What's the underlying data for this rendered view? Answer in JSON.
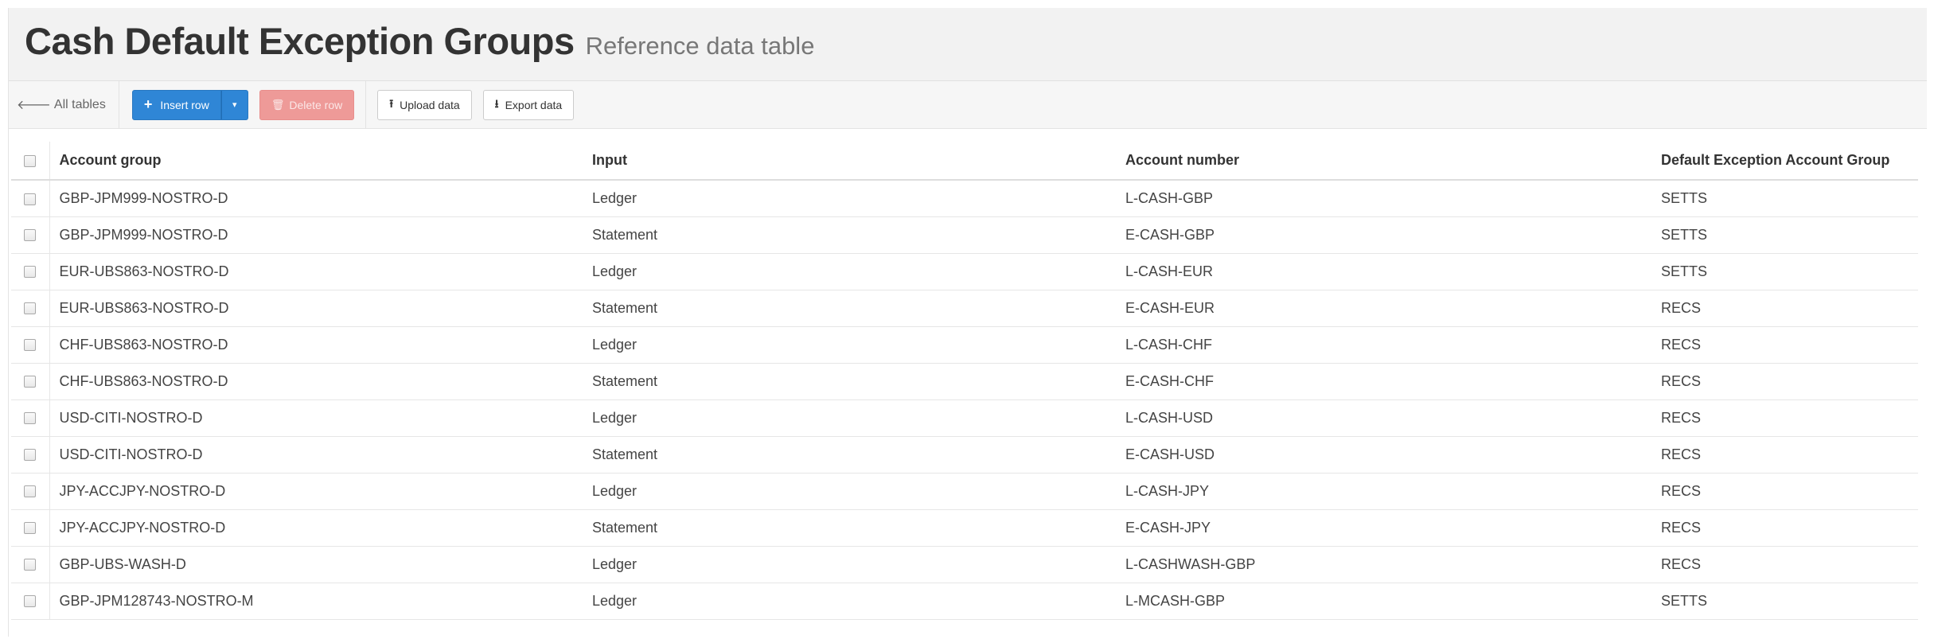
{
  "header": {
    "title": "Cash Default Exception Groups",
    "subtitle": "Reference data table"
  },
  "toolbar": {
    "back_label": "All tables",
    "insert_label": "Insert row",
    "delete_label": "Delete row",
    "upload_label": "Upload data",
    "export_label": "Export data"
  },
  "colors": {
    "primary": "#2f86d6",
    "danger": "#ee9a98"
  },
  "table": {
    "columns": [
      "Account group",
      "Input",
      "Account number",
      "Default Exception Account Group"
    ],
    "rows": [
      {
        "group": "GBP-JPM999-NOSTRO-D",
        "input": "Ledger",
        "account": "L-CASH-GBP",
        "default": "SETTS"
      },
      {
        "group": "GBP-JPM999-NOSTRO-D",
        "input": "Statement",
        "account": "E-CASH-GBP",
        "default": "SETTS"
      },
      {
        "group": "EUR-UBS863-NOSTRO-D",
        "input": "Ledger",
        "account": "L-CASH-EUR",
        "default": "SETTS"
      },
      {
        "group": "EUR-UBS863-NOSTRO-D",
        "input": "Statement",
        "account": "E-CASH-EUR",
        "default": "RECS"
      },
      {
        "group": "CHF-UBS863-NOSTRO-D",
        "input": "Ledger",
        "account": "L-CASH-CHF",
        "default": "RECS"
      },
      {
        "group": "CHF-UBS863-NOSTRO-D",
        "input": "Statement",
        "account": "E-CASH-CHF",
        "default": "RECS"
      },
      {
        "group": "USD-CITI-NOSTRO-D",
        "input": "Ledger",
        "account": "L-CASH-USD",
        "default": "RECS"
      },
      {
        "group": "USD-CITI-NOSTRO-D",
        "input": "Statement",
        "account": "E-CASH-USD",
        "default": "RECS"
      },
      {
        "group": "JPY-ACCJPY-NOSTRO-D",
        "input": "Ledger",
        "account": "L-CASH-JPY",
        "default": "RECS"
      },
      {
        "group": "JPY-ACCJPY-NOSTRO-D",
        "input": "Statement",
        "account": "E-CASH-JPY",
        "default": "RECS"
      },
      {
        "group": "GBP-UBS-WASH-D",
        "input": "Ledger",
        "account": "L-CASHWASH-GBP",
        "default": "RECS"
      },
      {
        "group": "GBP-JPM128743-NOSTRO-M",
        "input": "Ledger",
        "account": "L-MCASH-GBP",
        "default": "SETTS"
      }
    ]
  }
}
